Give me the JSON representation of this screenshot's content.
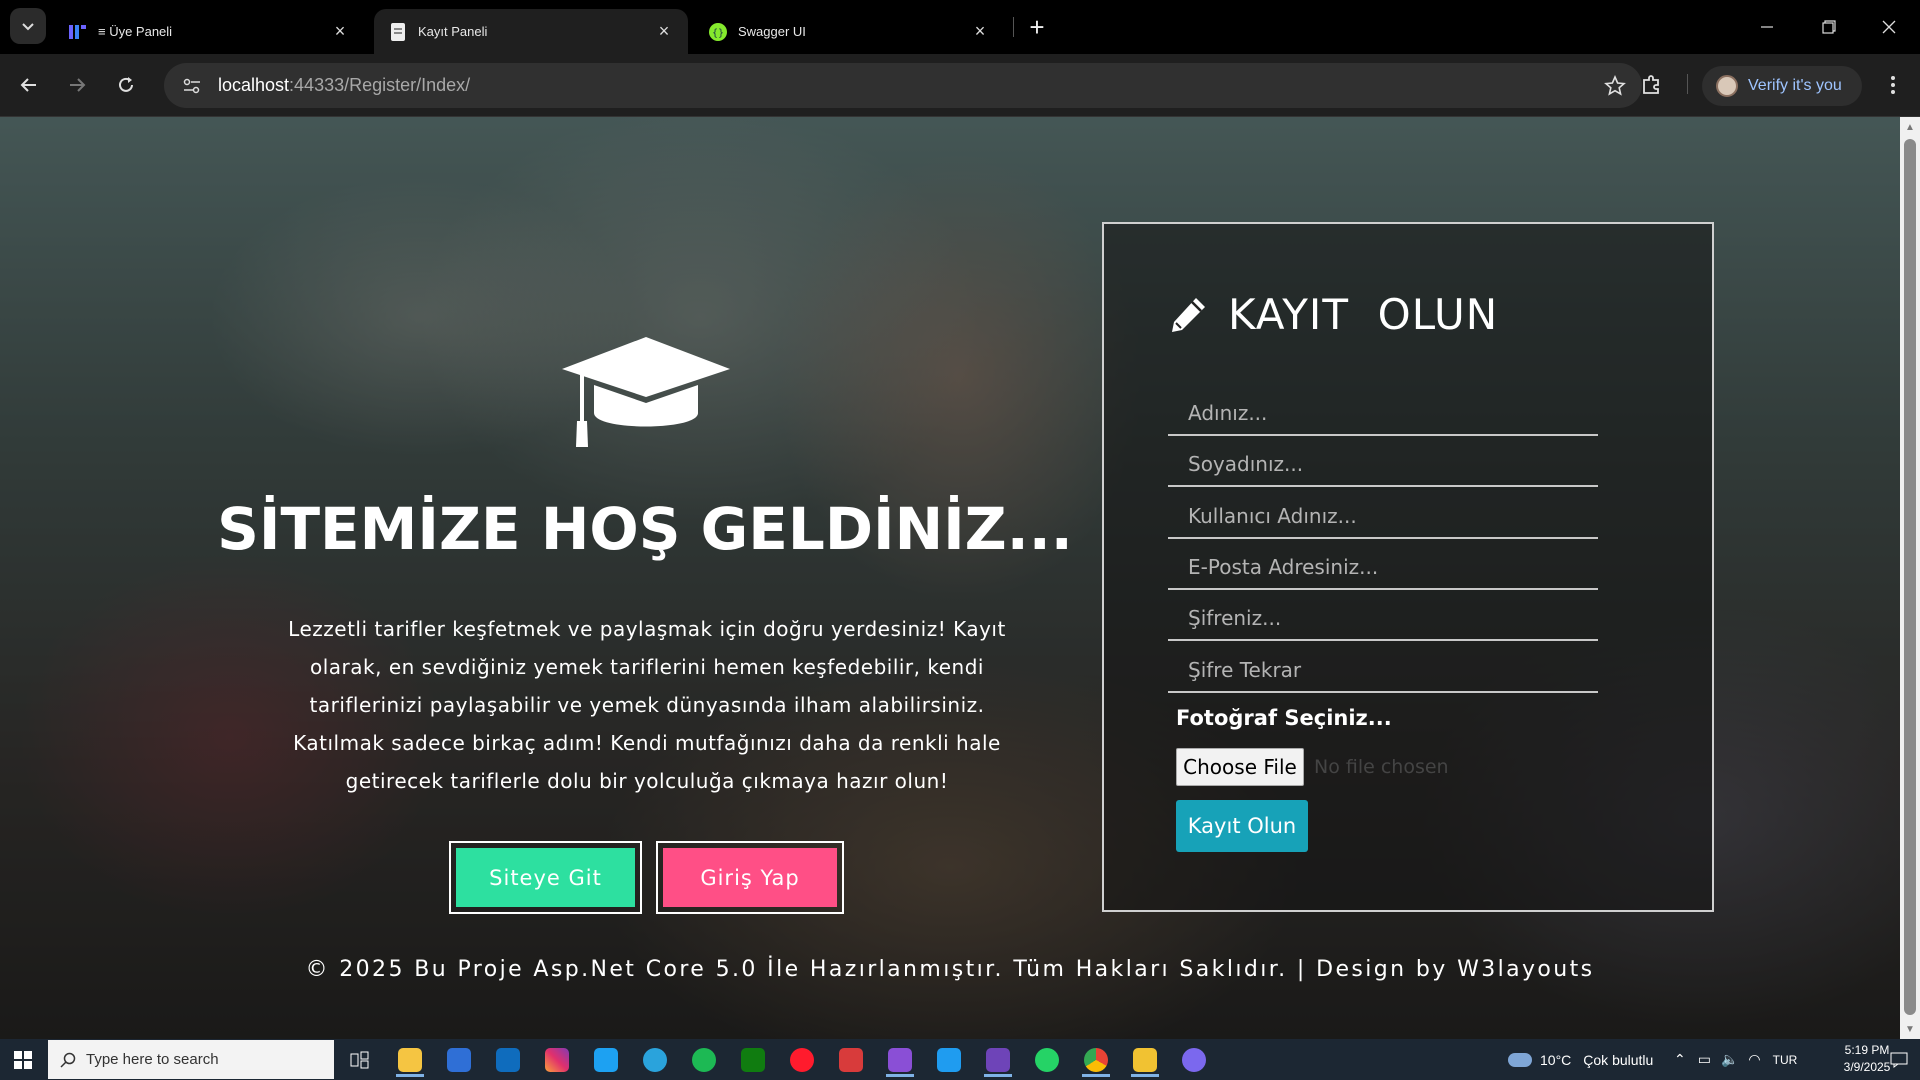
{
  "browser": {
    "tabs": [
      {
        "title": "≡ Üye Paneli",
        "active": false
      },
      {
        "title": "Kayıt Paneli",
        "active": true
      },
      {
        "title": "Swagger UI",
        "active": false
      }
    ],
    "url_host": "localhost",
    "url_rest": ":44333/Register/Index/",
    "verify_label": "Verify it's you"
  },
  "hero": {
    "title": "SİTEMİZE HOŞ GELDİNİZ...",
    "intro": "Lezzetli tarifler keşfetmek ve paylaşmak için doğru yerdesiniz! Kayıt olarak, en sevdiğiniz yemek tariflerini hemen keşfedebilir, kendi tariflerinizi paylaşabilir ve yemek dünyasında ilham alabilirsiniz. Katılmak sadece birkaç adım! Kendi mutfağınızı daha da renkli hale getirecek tariflerle dolu bir yolculuğa çıkmaya hazır olun!",
    "site_button": "Siteye Git",
    "login_button": "Giriş Yap"
  },
  "register": {
    "title": "KAYIT  OLUN",
    "fields": [
      {
        "placeholder": "Adınız..."
      },
      {
        "placeholder": "Soyadınız..."
      },
      {
        "placeholder": "Kullanıcı Adınız..."
      },
      {
        "placeholder": "E-Posta Adresiniz..."
      },
      {
        "placeholder": "Şifreniz..."
      },
      {
        "placeholder": "Şifre Tekrar"
      }
    ],
    "photo_label": "Fotoğraf Seçiniz...",
    "file_button": "Choose File",
    "file_status": "No file chosen",
    "submit": "Kayıt Olun"
  },
  "footer": "© 2025 Bu Proje Asp.Net Core 5.0 İle Hazırlanmıştır. Tüm Hakları Saklıdır. | Design by W3layouts",
  "taskbar": {
    "search_placeholder": "Type here to search",
    "weather_temp": "10°C",
    "weather_desc": "Çok bulutlu",
    "lang": "TUR",
    "time": "5:19 PM",
    "date": "3/9/2025"
  },
  "colors": {
    "site_button": "#2de0a0",
    "login_button": "#ff4f86",
    "submit_button": "#17a2b8",
    "verify_text": "#9ec4ff"
  }
}
